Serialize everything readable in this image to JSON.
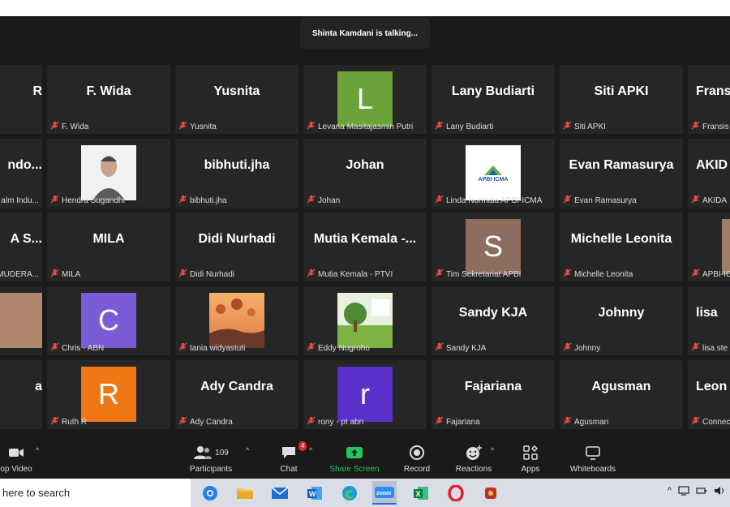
{
  "meeting": {
    "talking_banner": "Shinta Kamdani is talking..."
  },
  "tiles": [
    {
      "big": "R",
      "caption": ""
    },
    {
      "big": "F. Wida",
      "caption": "F. Wida"
    },
    {
      "big": "Yusnita",
      "caption": "Yusnita"
    },
    {
      "big": "",
      "caption": "Levana Masitajasmin Putri",
      "avatar_letter": "L",
      "avatar_color": "#6aa33a"
    },
    {
      "big": "Lany Budiarti",
      "caption": "Lany Budiarti"
    },
    {
      "big": "Siti APKI",
      "caption": "Siti APKI"
    },
    {
      "big": "Fransis",
      "caption": "Fransis"
    },
    {
      "big": "ndo...",
      "caption": "alm Indu..."
    },
    {
      "big": "",
      "caption": "Hendra Sugandhi",
      "photo": "portrait"
    },
    {
      "big": "bibhuti.jha",
      "caption": "bibhuti.jha"
    },
    {
      "big": "Johan",
      "caption": "Johan"
    },
    {
      "big": "",
      "caption": "Linda Nurmala APBI-ICMA",
      "logo_text": "APBI·ICMA"
    },
    {
      "big": "Evan Ramasurya",
      "caption": "Evan Ramasurya"
    },
    {
      "big": "AKID",
      "caption": "AKIDA"
    },
    {
      "big": "A S...",
      "caption": "MUDERA..."
    },
    {
      "big": "MILA",
      "caption": "MILA"
    },
    {
      "big": "Didi Nurhadi",
      "caption": "Didi Nurhadi"
    },
    {
      "big": "Mutia Kemala -...",
      "caption": "Mutia Kemala - PTVI"
    },
    {
      "big": "",
      "caption": "Tim Sekretariat APBI",
      "avatar_letter": "S",
      "avatar_color": "#8c6d5e"
    },
    {
      "big": "Michelle Leonita",
      "caption": "Michelle Leonita"
    },
    {
      "big": "",
      "caption": "APBI-IC",
      "photo": "partial"
    },
    {
      "big": "",
      "caption": "",
      "photo": "partial-left"
    },
    {
      "big": "",
      "caption": "Chris - ABN",
      "avatar_letter": "C",
      "avatar_color": "#7b5bd6"
    },
    {
      "big": "",
      "caption": "tania widyastuti",
      "photo": "balloons"
    },
    {
      "big": "",
      "caption": "Eddy Nugroho",
      "photo": "tree"
    },
    {
      "big": "Sandy KJA",
      "caption": "Sandy KJA"
    },
    {
      "big": "Johnny",
      "caption": "Johnny"
    },
    {
      "big": "lisa",
      "caption": "lisa ste"
    },
    {
      "big": "a",
      "caption": ""
    },
    {
      "big": "",
      "caption": "Ruth R",
      "avatar_letter": "R",
      "avatar_color": "#f07814"
    },
    {
      "big": "Ady Candra",
      "caption": "Ady Candra"
    },
    {
      "big": "",
      "caption": "rony - pt abn",
      "avatar_letter": "r",
      "avatar_color": "#5b2fc9"
    },
    {
      "big": "Fajariana",
      "caption": "Fajariana"
    },
    {
      "big": "Agusman",
      "caption": "Agusman"
    },
    {
      "big": "Leon",
      "caption": "Connectin"
    }
  ],
  "toolbar": {
    "video_label": "op Video",
    "participants_label": "Participants",
    "participants_count": "109",
    "chat_label": "Chat",
    "chat_badge": "4",
    "share_label": "Share Screen",
    "record_label": "Record",
    "reactions_label": "Reactions",
    "apps_label": "Apps",
    "whiteboards_label": "Whiteboards"
  },
  "taskbar": {
    "search_placeholder": "here to search",
    "apps": [
      "chrome-icon",
      "file-explorer-icon",
      "mail-icon",
      "word-icon",
      "edge-icon",
      "zoom-icon",
      "excel-icon",
      "opera-icon",
      "other-app-icon"
    ]
  },
  "colors": {
    "meeting_bg": "#1a1a1a",
    "tile_bg": "#262626",
    "share_green": "#22c55e",
    "badge_red": "#e02828"
  }
}
